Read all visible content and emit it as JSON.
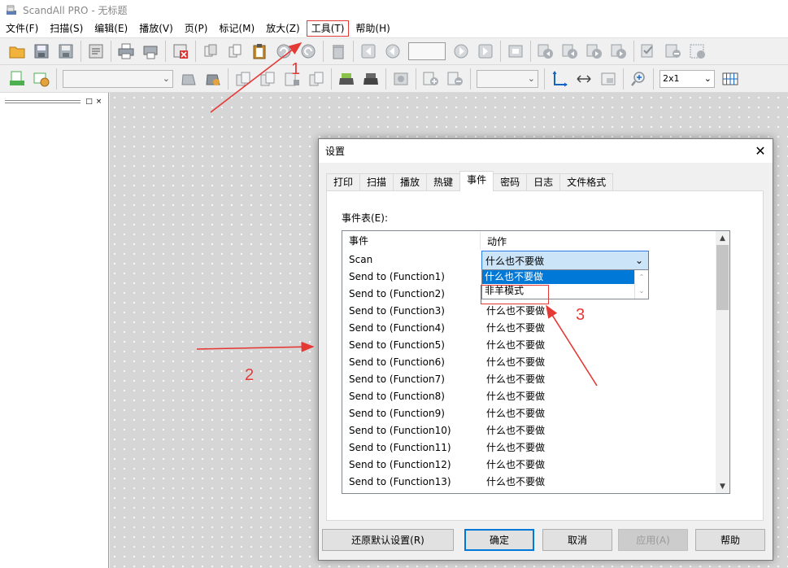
{
  "window": {
    "title": "ScandAll PRO - 无标题",
    "app_icon": "scanner-app-icon"
  },
  "menu": [
    {
      "label": "文件(F)"
    },
    {
      "label": "扫描(S)"
    },
    {
      "label": "编辑(E)"
    },
    {
      "label": "播放(V)"
    },
    {
      "label": "页(P)"
    },
    {
      "label": "标记(M)"
    },
    {
      "label": "放大(Z)"
    },
    {
      "label": "工具(T)"
    },
    {
      "label": "帮助(H)"
    }
  ],
  "toolbar2": {
    "zoom_value": "2x1"
  },
  "dialog": {
    "title": "设置",
    "tabs": [
      "打印",
      "扫描",
      "播放",
      "热键",
      "事件",
      "密码",
      "日志",
      "文件格式"
    ],
    "active_tab": "事件",
    "event_table_label": "事件表(E):",
    "columns": [
      "事件",
      "动作"
    ],
    "rows": [
      {
        "event": "Scan",
        "action": "什么也不要做"
      },
      {
        "event": "Send to (Function1)",
        "action": ""
      },
      {
        "event": "Send to (Function2)",
        "action": ""
      },
      {
        "event": "Send to (Function3)",
        "action": "什么也不要做"
      },
      {
        "event": "Send to (Function4)",
        "action": "什么也不要做"
      },
      {
        "event": "Send to (Function5)",
        "action": "什么也不要做"
      },
      {
        "event": "Send to (Function6)",
        "action": "什么也不要做"
      },
      {
        "event": "Send to (Function7)",
        "action": "什么也不要做"
      },
      {
        "event": "Send to (Function8)",
        "action": "什么也不要做"
      },
      {
        "event": "Send to (Function9)",
        "action": "什么也不要做"
      },
      {
        "event": "Send to (Function10)",
        "action": "什么也不要做"
      },
      {
        "event": "Send to (Function11)",
        "action": "什么也不要做"
      },
      {
        "event": "Send to (Function12)",
        "action": "什么也不要做"
      },
      {
        "event": "Send to (Function13)",
        "action": "什么也不要做"
      }
    ],
    "action_select": {
      "value": "什么也不要做",
      "options": [
        "什么也不要做",
        "非羊模式"
      ]
    },
    "buttons": {
      "restore": "还原默认设置(R)",
      "ok": "确定",
      "cancel": "取消",
      "apply": "应用(A)",
      "help": "帮助"
    }
  },
  "annotations": {
    "step1": "1",
    "step2": "2",
    "step3": "3",
    "color": "#e53935"
  }
}
